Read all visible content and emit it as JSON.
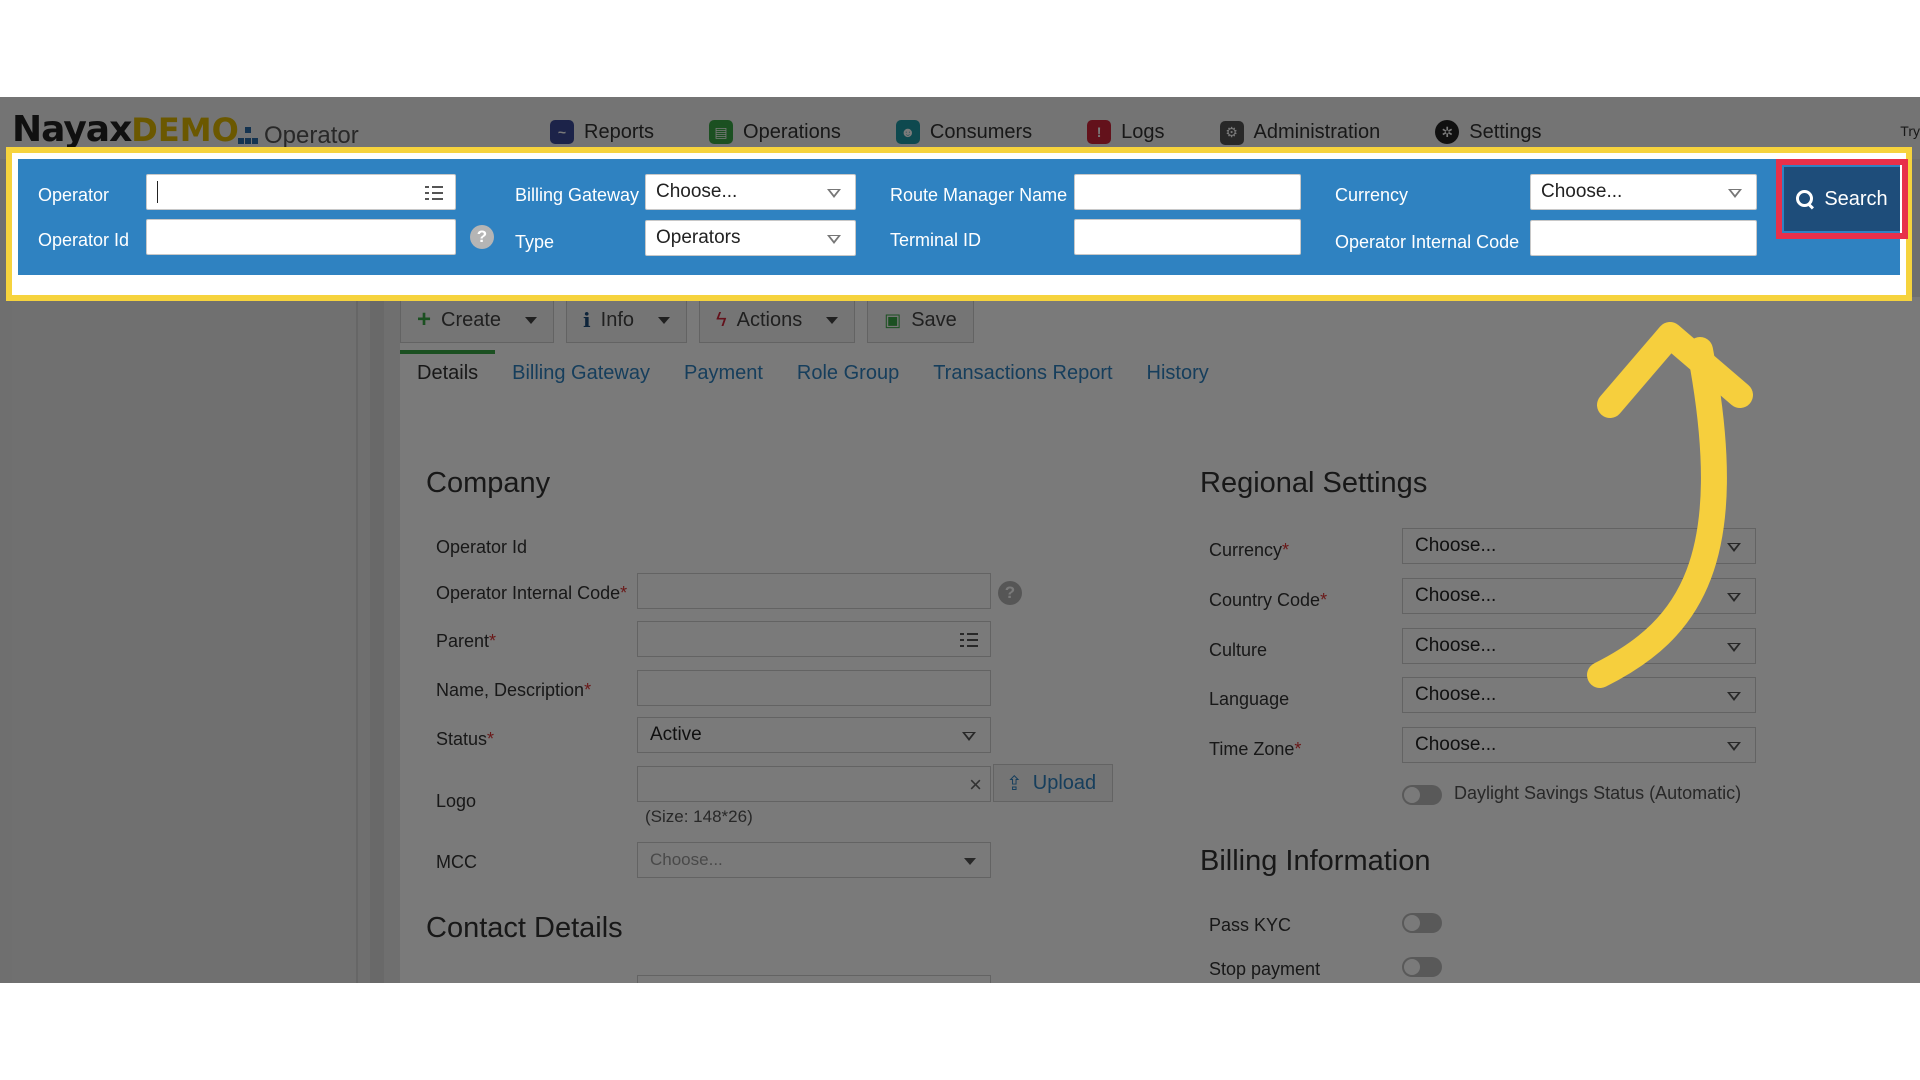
{
  "header": {
    "logo_brand": "Nayax",
    "logo_demo": "DEMO",
    "app_name": "Operator",
    "nav": [
      {
        "label": "Reports",
        "icon": "chart-icon",
        "color": "#3b4a9a"
      },
      {
        "label": "Operations",
        "icon": "operations-icon",
        "color": "#3aa845"
      },
      {
        "label": "Consumers",
        "icon": "consumers-icon",
        "color": "#1f9aa6"
      },
      {
        "label": "Logs",
        "icon": "alert-icon",
        "color": "#d0243a"
      },
      {
        "label": "Administration",
        "icon": "administration-icon",
        "color": "#555555"
      },
      {
        "label": "Settings",
        "icon": "gear-icon",
        "color": "#222222"
      }
    ],
    "try_label": "Try"
  },
  "search_panel": {
    "operator_label": "Operator",
    "operator_value": "",
    "operator_id_label": "Operator Id",
    "billing_gateway_label": "Billing Gateway",
    "billing_gateway_value": "Choose...",
    "type_label": "Type",
    "type_value": "Operators",
    "route_manager_label": "Route Manager Name",
    "terminal_id_label": "Terminal ID",
    "currency_label": "Currency",
    "currency_value": "Choose...",
    "operator_internal_code_label": "Operator Internal Code",
    "search_label": "Search",
    "accent": "#2f82c1",
    "highlight": "#f6d33d",
    "button_highlight": "#e8304a"
  },
  "toolbar": {
    "create": "Create",
    "info": "Info",
    "actions": "Actions",
    "save": "Save"
  },
  "tabs": [
    "Details",
    "Billing Gateway",
    "Payment",
    "Role Group",
    "Transactions Report",
    "History"
  ],
  "company": {
    "title": "Company",
    "operator_id": "Operator Id",
    "internal_code": "Operator Internal Code",
    "parent": "Parent",
    "name_desc": "Name, Description",
    "status": "Status",
    "status_value": "Active",
    "logo": "Logo",
    "upload": "Upload",
    "size_hint": "(Size: 148*26)",
    "mcc": "MCC",
    "mcc_value": "Choose..."
  },
  "contact": {
    "title": "Contact Details"
  },
  "regional": {
    "title": "Regional Settings",
    "currency": "Currency",
    "country_code": "Country Code",
    "culture": "Culture",
    "language": "Language",
    "time_zone": "Time Zone",
    "choose": "Choose...",
    "daylight": "Daylight Savings Status (Automatic)"
  },
  "billing": {
    "title": "Billing Information",
    "pass_kyc": "Pass KYC",
    "stop_payment": "Stop payment"
  }
}
